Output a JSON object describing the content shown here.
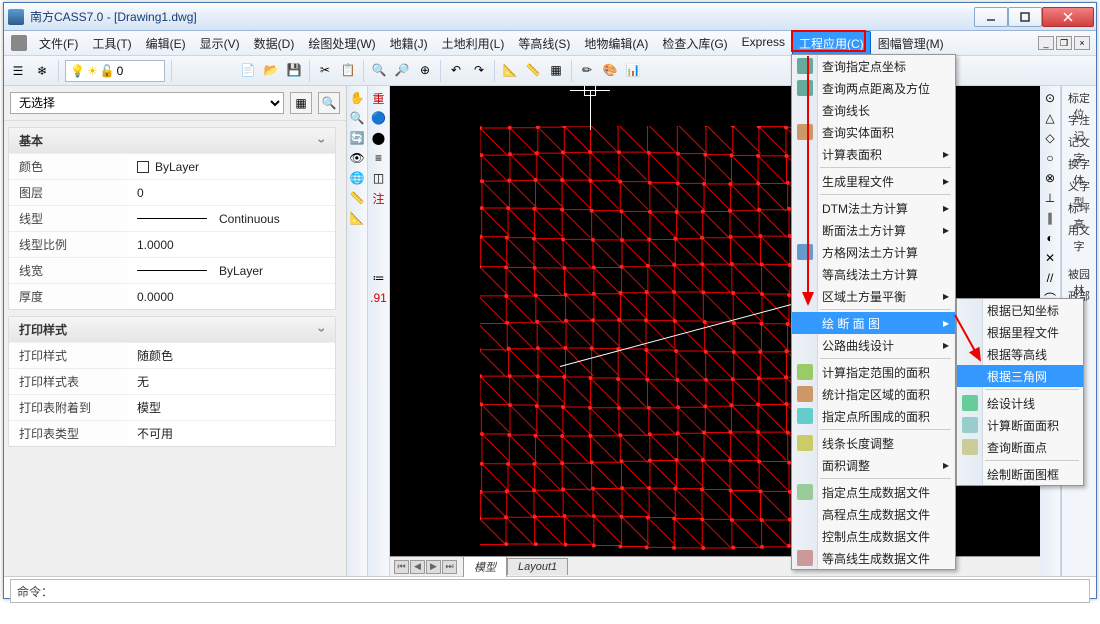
{
  "title": "南方CASS7.0 - [Drawing1.dwg]",
  "menubar": {
    "items": [
      "文件(F)",
      "工具(T)",
      "编辑(E)",
      "显示(V)",
      "数据(D)",
      "绘图处理(W)",
      "地籍(J)",
      "土地利用(L)",
      "等高线(S)",
      "地物编辑(A)",
      "检查入库(G)",
      "Express",
      "工程应用(C)",
      "图幅管理(M)"
    ],
    "highlight": 12
  },
  "props": {
    "noselect": "无选择",
    "group1": {
      "title": "基本",
      "rows": [
        {
          "k": "颜色",
          "v": "ByLayer",
          "swatch": true
        },
        {
          "k": "图层",
          "v": "0"
        },
        {
          "k": "线型",
          "v": "Continuous",
          "line": true
        },
        {
          "k": "线型比例",
          "v": "1.0000"
        },
        {
          "k": "线宽",
          "v": "ByLayer",
          "line": true
        },
        {
          "k": "厚度",
          "v": "0.0000"
        }
      ]
    },
    "group2": {
      "title": "打印样式",
      "rows": [
        {
          "k": "打印样式",
          "v": "随颜色"
        },
        {
          "k": "打印样式表",
          "v": "无"
        },
        {
          "k": "打印表附着到",
          "v": "模型"
        },
        {
          "k": "打印表类型",
          "v": "不可用"
        }
      ]
    }
  },
  "tabs": {
    "model": "模型",
    "layout": "Layout1"
  },
  "cmd": {
    "prompt": "命令："
  },
  "vbar_left": [
    "✋",
    "🔍",
    "🔄",
    "👁",
    "🌐",
    "📏",
    "📐"
  ],
  "vbar_mid": [
    "重",
    "🔵",
    "⬤",
    "≡",
    "◫",
    "注",
    "",
    "",
    "",
    "≔",
    ".91",
    "",
    "",
    "",
    ""
  ],
  "menu1": {
    "items": [
      {
        "t": "查询指定点坐标",
        "i": "#6a9"
      },
      {
        "t": "查询两点距离及方位",
        "i": "#6a9"
      },
      {
        "t": "查询线长"
      },
      {
        "t": "查询实体面积",
        "i": "#c96"
      },
      {
        "t": "计算表面积",
        "sub": true
      },
      "-",
      {
        "t": "生成里程文件",
        "sub": true
      },
      "-",
      {
        "t": "DTM法土方计算",
        "sub": true
      },
      {
        "t": "断面法土方计算",
        "sub": true
      },
      {
        "t": "方格网法土方计算",
        "i": "#69c"
      },
      {
        "t": "等高线法土方计算"
      },
      {
        "t": "区域土方量平衡",
        "sub": true
      },
      "-",
      {
        "t": "绘 断 面 图",
        "sub": true,
        "hl": true
      },
      {
        "t": "公路曲线设计",
        "sub": true
      },
      "-",
      {
        "t": "计算指定范围的面积",
        "i": "#9c6"
      },
      {
        "t": "统计指定区域的面积",
        "i": "#c96"
      },
      {
        "t": "指定点所围成的面积",
        "i": "#6cc"
      },
      "-",
      {
        "t": "线条长度调整",
        "i": "#cc6"
      },
      {
        "t": "面积调整",
        "sub": true
      },
      "-",
      {
        "t": "指定点生成数据文件",
        "i": "#9c9"
      },
      {
        "t": "高程点生成数据文件"
      },
      {
        "t": "控制点生成数据文件"
      },
      {
        "t": "等高线生成数据文件",
        "i": "#c99"
      }
    ]
  },
  "menu2": {
    "items": [
      {
        "t": "根据已知坐标"
      },
      {
        "t": "根据里程文件"
      },
      {
        "t": "根据等高线"
      },
      {
        "t": "根据三角网",
        "hl": true
      },
      "-",
      {
        "t": "绘设计线",
        "i": "#6c9"
      },
      {
        "t": "计算断面面积",
        "i": "#9cc"
      },
      {
        "t": "查询断面点",
        "i": "#cc9"
      },
      "-",
      {
        "t": "绘制断面图框"
      }
    ]
  },
  "rside": [
    "标定位",
    "字注记",
    "记文字",
    "换字体",
    "义字型",
    "标坪高",
    "用文字",
    "",
    "被园林",
    "政部件"
  ]
}
